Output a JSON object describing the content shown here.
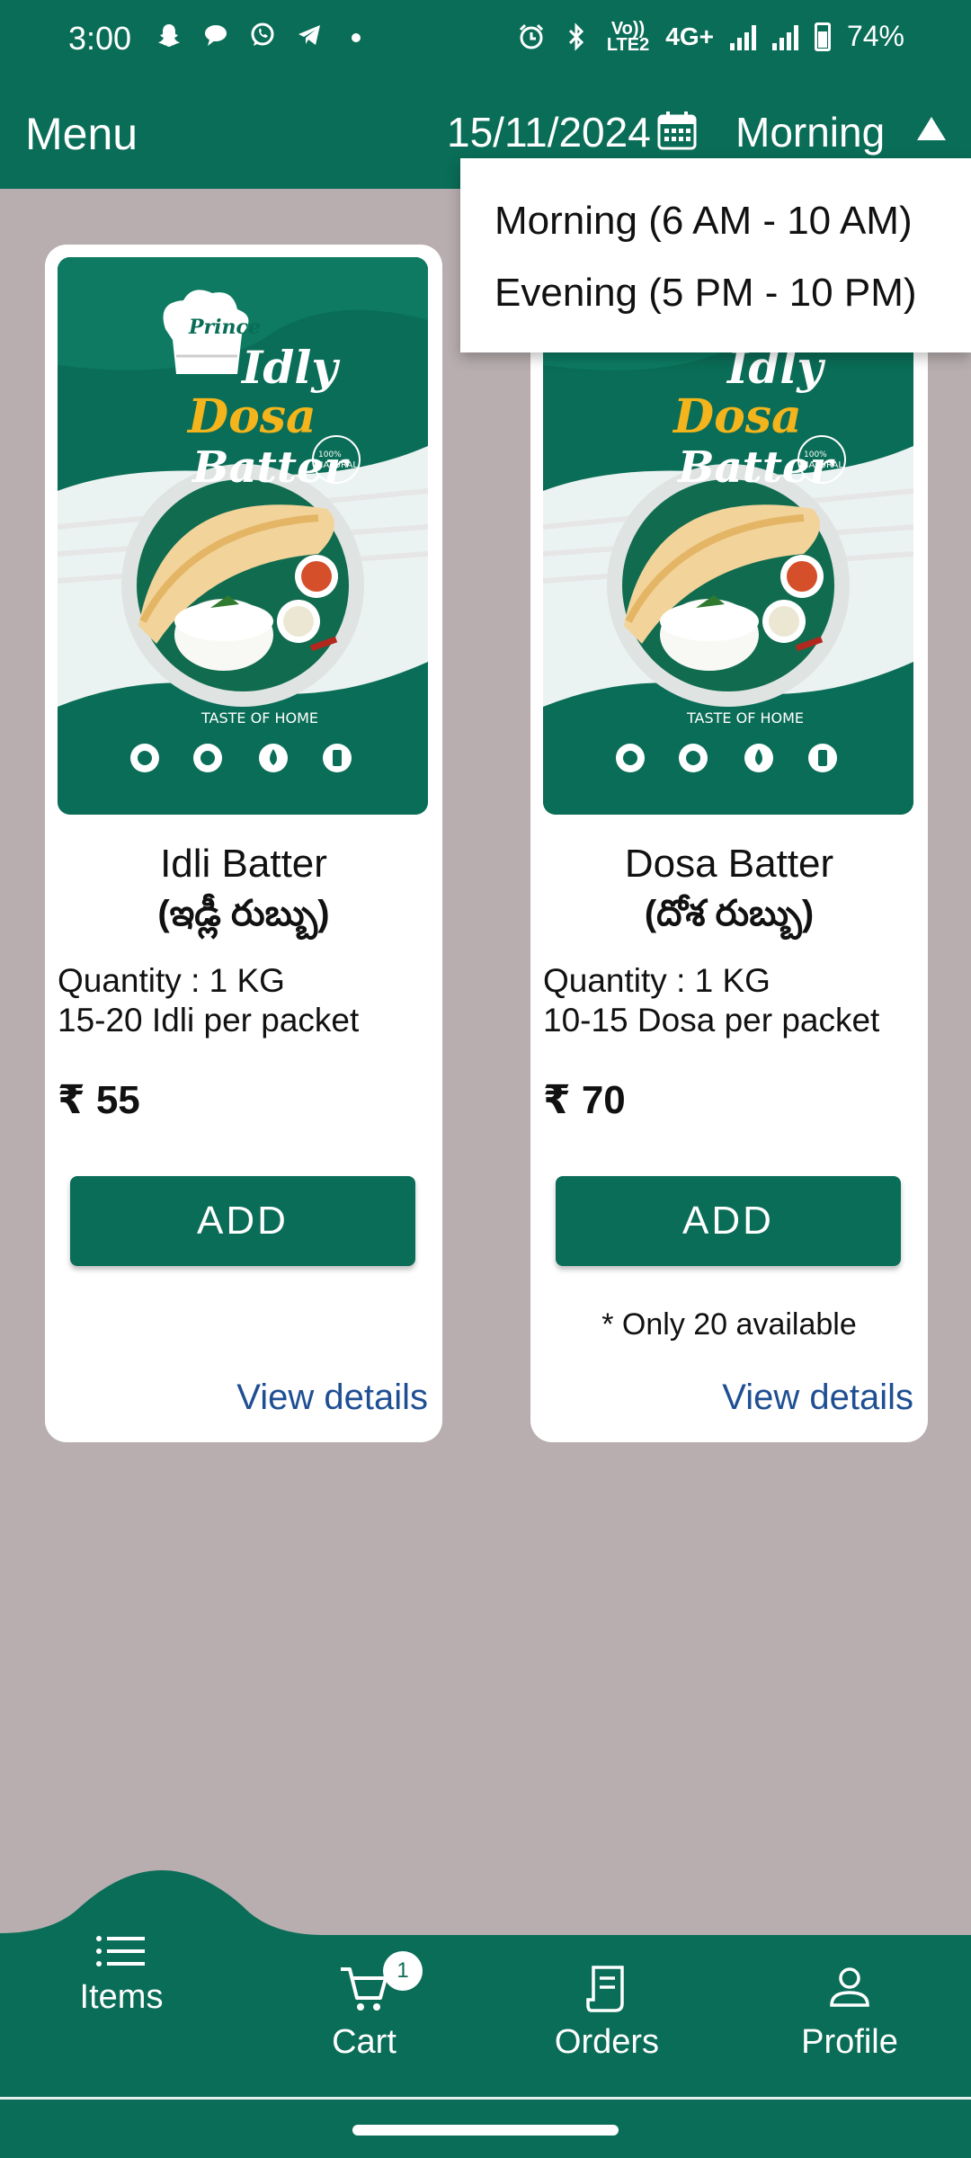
{
  "status_bar": {
    "time": "3:00",
    "network_label_top": "Vo))",
    "network_label_bottom": "LTE2",
    "network_type": "4G+",
    "battery": "74%",
    "icons": [
      "snapchat-icon",
      "chat-icon",
      "whatsapp-icon",
      "telegram-icon",
      "dot-icon",
      "alarm-icon",
      "bluetooth-icon",
      "signal-icon",
      "battery-icon"
    ]
  },
  "app_bar": {
    "title": "Menu",
    "date": "15/11/2024",
    "slot": "Morning"
  },
  "slot_dropdown": {
    "options": [
      "Morning (6 AM - 10 AM)",
      "Evening (5 PM - 10 PM)"
    ]
  },
  "products": [
    {
      "name": "Idli Batter",
      "name_local": "(ఇడ్లీ రుబ్బు)",
      "quantity": "Quantity : 1 KG",
      "per_packet": "15-20 Idli per packet",
      "price": "₹ 55",
      "button": "ADD",
      "availability": "",
      "details_link": "View details"
    },
    {
      "name": "Dosa Batter",
      "name_local": "(దోశ రుబ్బు)",
      "quantity": "Quantity : 1 KG",
      "per_packet": "10-15 Dosa per packet",
      "price": "₹ 70",
      "button": "ADD",
      "availability": "* Only 20 available",
      "details_link": "View details"
    }
  ],
  "product_image": {
    "brand": "Prince",
    "line1": "Idly",
    "line2": "Dosa",
    "line3": "Batter",
    "badge": "100% NATURAL",
    "tagline": "TASTE OF HOME"
  },
  "bottom_nav": {
    "items": [
      {
        "label": "Items",
        "icon": "list-icon"
      },
      {
        "label": "Cart",
        "icon": "cart-icon",
        "badge": "1"
      },
      {
        "label": "Orders",
        "icon": "receipt-icon"
      },
      {
        "label": "Profile",
        "icon": "person-icon"
      }
    ]
  },
  "colors": {
    "primary": "#0a6d57",
    "background": "#b8aeb0",
    "link": "#1f4f93",
    "accent_yellow": "#f3b41c"
  }
}
